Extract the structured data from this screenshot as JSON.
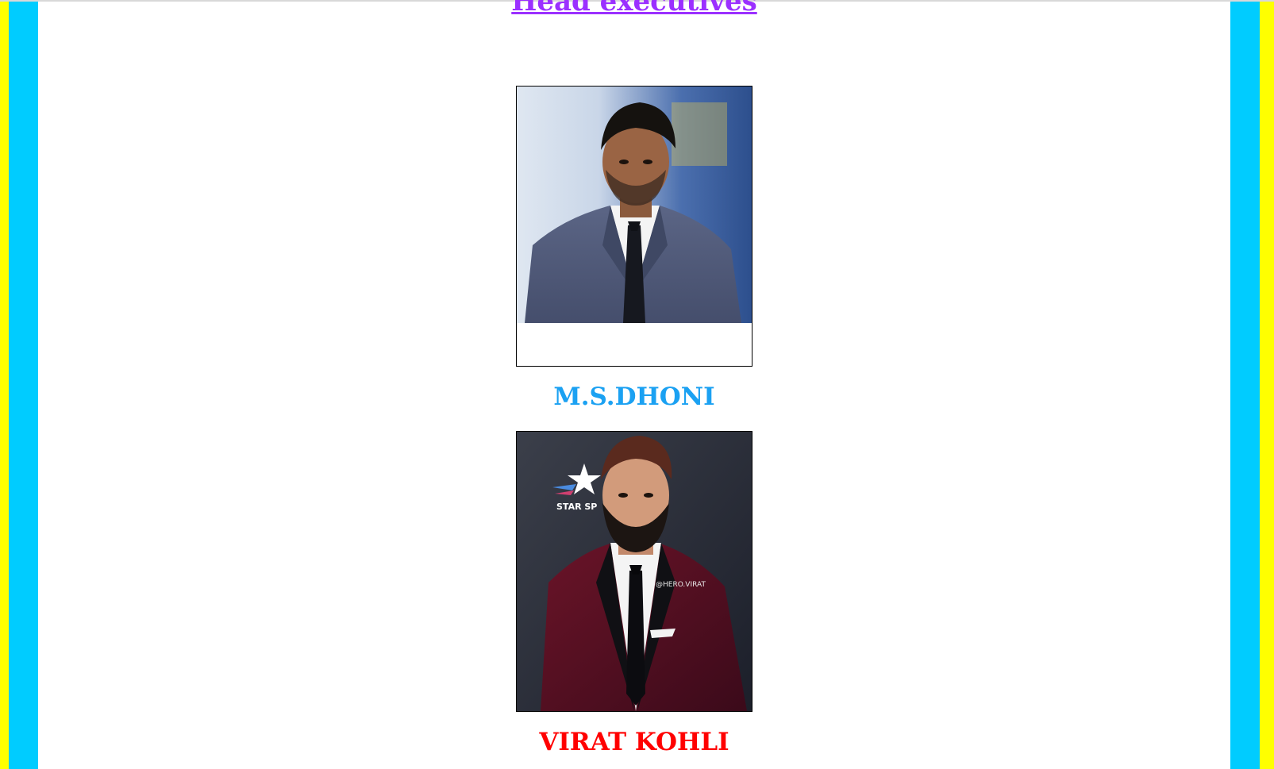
{
  "page": {
    "title": "Head executives",
    "colors": {
      "outer_border": "#ffff00",
      "inner_border": "#00ccff",
      "title": "#9b30ff"
    }
  },
  "executives": [
    {
      "name": "M.S.DHONI",
      "name_color": "#1ba1f2",
      "photo": "photo-portrait"
    },
    {
      "name": "VIRAT KOHLI",
      "name_color": "#ff0000",
      "photo": "photo-portrait",
      "photo_watermark": "@HERO.VIRAT",
      "backdrop_logo_text": "STAR SP"
    }
  ]
}
